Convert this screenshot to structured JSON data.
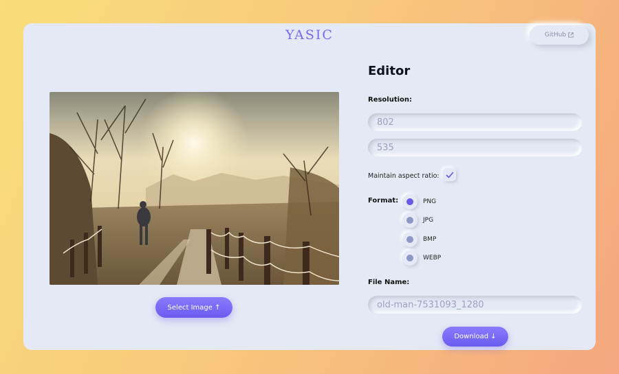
{
  "app": {
    "logo": "YASIC"
  },
  "header": {
    "github_label": "GitHub"
  },
  "preview": {
    "select_label": "Select Image ↑"
  },
  "editor": {
    "title": "Editor",
    "resolution_label": "Resolution:",
    "width_value": "802",
    "height_value": "535",
    "aspect_label": "Maintain aspect ratio:",
    "aspect_checked": true,
    "format_label": "Format:",
    "formats": [
      {
        "label": "PNG",
        "selected": true
      },
      {
        "label": "JPG",
        "selected": false
      },
      {
        "label": "BMP",
        "selected": false
      },
      {
        "label": "WEBP",
        "selected": false
      }
    ],
    "filename_label": "File Name:",
    "filename_value": "old-man-7531093_1280",
    "download_label": "Download ↓"
  },
  "colors": {
    "accent": "#7b68ee",
    "panel": "#e4e9f5",
    "button_gradient_top": "#8a7bff",
    "button_gradient_bottom": "#6a5cf0"
  }
}
